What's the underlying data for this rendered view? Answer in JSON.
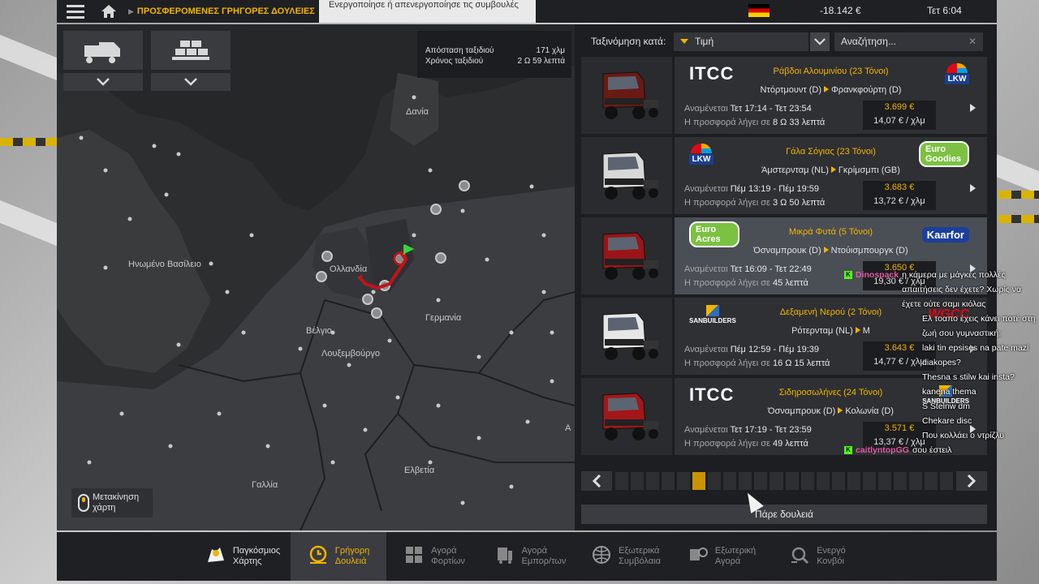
{
  "topbar": {
    "breadcrumb": "ΠΡΟΣΦΕΡΟΜΕΝΕΣ ΓΡΗΓΟΡΕΣ ΔΟΥΛΕΙΕΣ",
    "help": "?",
    "tips_toggle": "Ενεργοποίησε ή απενεργοποίησε τις συμβουλές",
    "money": "-18.142 €",
    "clock": "Τετ 6:04"
  },
  "map": {
    "labels": {
      "denmark": "Δανία",
      "uk": "Ηνωμένο Βασίλειο",
      "netherlands": "Ολλανδία",
      "belgium": "Βέλγιο",
      "luxembourg": "Λουξεμβούργο",
      "germany": "Γερμανία",
      "switzerland": "Ελβετία",
      "france": "Γαλλία",
      "austria": "Α"
    },
    "trip": {
      "distance_label": "Απόσταση ταξιδιού",
      "distance_value": "171 χλμ",
      "time_label": "Χρόνος ταξιδιού",
      "time_value": "2 Ω 59 λεπτά"
    },
    "move_map": "Μετακίνηση χάρτη"
  },
  "sort": {
    "label": "Ταξινόμηση κατά:",
    "value": "Τιμή",
    "search_placeholder": "Αναζήτηση..."
  },
  "jobs": [
    {
      "cargo": "Ράβδοι Αλουμινίου (23 Τόνοι)",
      "from": "Ντόρτμουντ (D)",
      "to": "Φρανκφούρτη (D)",
      "expected_label": "Αναμένεται",
      "expected": "Τετ 17:14 - Τετ 23:54",
      "expiry_label": "Η προσφορά λήγει σε",
      "expiry": "8 Ω 33 λεπτά",
      "pay_total": "3.699 €",
      "pay_per": "14,07 € / χλμ",
      "from_logo": "ITCC",
      "to_logo": "LKW",
      "truck_color": "#6a1a14"
    },
    {
      "cargo": "Γάλα Σόγιας (23 Τόνοι)",
      "from": "Άμστερνταμ (NL)",
      "to": "Γκρίμσμπι (GB)",
      "expected_label": "Αναμένεται",
      "expected": "Πέμ 13:19 - Πέμ 19:59",
      "expiry_label": "Η προσφορά λήγει σε",
      "expiry": "3 Ω 50 λεπτά",
      "pay_total": "3.683 €",
      "pay_per": "13,72 € / χλμ",
      "from_logo": "LKW",
      "to_logo": "Euro Goodies",
      "truck_color": "#d8d8d8"
    },
    {
      "cargo": "Μικρά Φυτά (5 Τόνοι)",
      "from": "Όσναμπρουκ (D)",
      "to": "Ντούισμπουργκ (D)",
      "expected_label": "Αναμένεται",
      "expected": "Τετ 16:09 - Τετ 22:49",
      "expiry_label": "Η προσφορά λήγει σε",
      "expiry": "45 λεπτά",
      "pay_total": "3.650 €",
      "pay_per": "19,30 € / χλμ",
      "from_logo": "Euro Acres",
      "to_logo": "Kaarfor",
      "truck_color": "#9a1418"
    },
    {
      "cargo": "Δεξαμενή Νερού (2 Τόνοι)",
      "from": "Ρότερνταμ (NL)",
      "to": "Μ",
      "expected_label": "Αναμένεται",
      "expected": "Πέμ 12:59 - Πέμ 19:39",
      "expiry_label": "Η προσφορά λήγει σε",
      "expiry": "16 Ω 15 λεπτά",
      "pay_total": "3.643 €",
      "pay_per": "14,77 € / χλμ",
      "from_logo": "SANBUILDERS",
      "to_logo": "WGCC",
      "truck_color": "#e6e6e6"
    },
    {
      "cargo": "Σιδηροσωλήνες (24 Τόνοι)",
      "from": "Όσναμπρουκ (D)",
      "to": "Κολωνία (D)",
      "expected_label": "Αναμένεται",
      "expected": "Τετ 17:19 - Τετ 23:59",
      "expiry_label": "Η προσφορά λήγει σε",
      "expiry": "49 λεπτά",
      "pay_total": "3.571 €",
      "pay_per": "13,37 € / χλμ",
      "from_logo": "ITCC",
      "to_logo": "SANBUILDERS",
      "truck_color": "#a4161a"
    }
  ],
  "take_job": "Πάρε δουλειά",
  "tabs": [
    {
      "line1": "Παγκόσμιος",
      "line2": "Χάρτης",
      "icon": "world-map-icon"
    },
    {
      "line1": "Γρήγορη",
      "line2": "Δουλειά",
      "icon": "clock-icon"
    },
    {
      "line1": "Αγορά",
      "line2": "Φορτίων",
      "icon": "cargo-market-icon"
    },
    {
      "line1": "Αγορά",
      "line2": "Εμπορ/των",
      "icon": "trailer-market-icon"
    },
    {
      "line1": "Εξωτερικά",
      "line2": "Συμβόλαια",
      "icon": "globe-contracts-icon"
    },
    {
      "line1": "Εξωτερική",
      "line2": "Αγορά",
      "icon": "external-market-icon"
    },
    {
      "line1": "Ενεργό",
      "line2": "Κονβόι",
      "icon": "convoy-icon"
    }
  ],
  "chat": [
    {
      "user": "Dinospack",
      "msg": "η κάμερα με μάγκες πολλές απαιτήσεις δεν έχετε? Χωρίς να έχετε ούτε σαμι κιόλας"
    },
    {
      "user": "",
      "msg": "Ελ τοαπο έχεις κάνει ποτέ στη ζωή σου γυμναστική;"
    },
    {
      "user": "",
      "msg": "laki tin epsises na pate mazi diakopes?"
    },
    {
      "user": "",
      "msg": "Thesna s stilw kai insta?"
    },
    {
      "user": "",
      "msg": "kanena thema"
    },
    {
      "user": "",
      "msg": "S Stelnw dm"
    },
    {
      "user": "",
      "msg": "Chekare disc"
    },
    {
      "user": "",
      "msg": "Που κολλάει ο ντρίζλυ"
    },
    {
      "user": "caitlyntopGG",
      "msg": "σου έστειλ"
    }
  ],
  "colors": {
    "accent": "#f2b400",
    "panel": "#1d1e21",
    "selected": "#4a4e55"
  }
}
